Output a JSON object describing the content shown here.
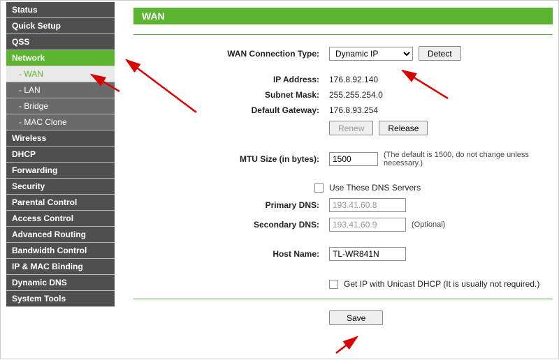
{
  "sidebar": {
    "items": [
      {
        "label": "Status",
        "type": "top"
      },
      {
        "label": "Quick Setup",
        "type": "top"
      },
      {
        "label": "QSS",
        "type": "top"
      },
      {
        "label": "Network",
        "type": "active-top"
      },
      {
        "label": "- WAN",
        "type": "active-sub"
      },
      {
        "label": "- LAN",
        "type": "sub"
      },
      {
        "label": "- Bridge",
        "type": "sub"
      },
      {
        "label": "- MAC Clone",
        "type": "sub"
      },
      {
        "label": "Wireless",
        "type": "top"
      },
      {
        "label": "DHCP",
        "type": "top"
      },
      {
        "label": "Forwarding",
        "type": "top"
      },
      {
        "label": "Security",
        "type": "top"
      },
      {
        "label": "Parental Control",
        "type": "top"
      },
      {
        "label": "Access Control",
        "type": "top"
      },
      {
        "label": "Advanced Routing",
        "type": "top"
      },
      {
        "label": "Bandwidth Control",
        "type": "top"
      },
      {
        "label": "IP & MAC Binding",
        "type": "top"
      },
      {
        "label": "Dynamic DNS",
        "type": "top"
      },
      {
        "label": "System Tools",
        "type": "top"
      }
    ]
  },
  "page": {
    "title": "WAN",
    "labels": {
      "conn_type": "WAN Connection Type:",
      "ip": "IP Address:",
      "mask": "Subnet Mask:",
      "gw": "Default Gateway:",
      "mtu": "MTU Size (in bytes):",
      "primary_dns": "Primary DNS:",
      "secondary_dns": "Secondary DNS:",
      "host": "Host Name:"
    },
    "values": {
      "conn_type": "Dynamic IP",
      "ip": "176.8.92.140",
      "mask": "255.255.254.0",
      "gw": "176.8.93.254",
      "mtu": "1500",
      "primary_dns": "193.41.60.8",
      "secondary_dns": "193.41.60.9",
      "host": "TL-WR841N"
    },
    "buttons": {
      "detect": "Detect",
      "renew": "Renew",
      "release": "Release",
      "save": "Save"
    },
    "text": {
      "mtu_note": "(The default is 1500, do not change unless necessary.)",
      "use_dns": "Use These DNS Servers",
      "optional": "(Optional)",
      "unicast": "Get IP with Unicast DHCP (It is usually not required.)"
    }
  }
}
